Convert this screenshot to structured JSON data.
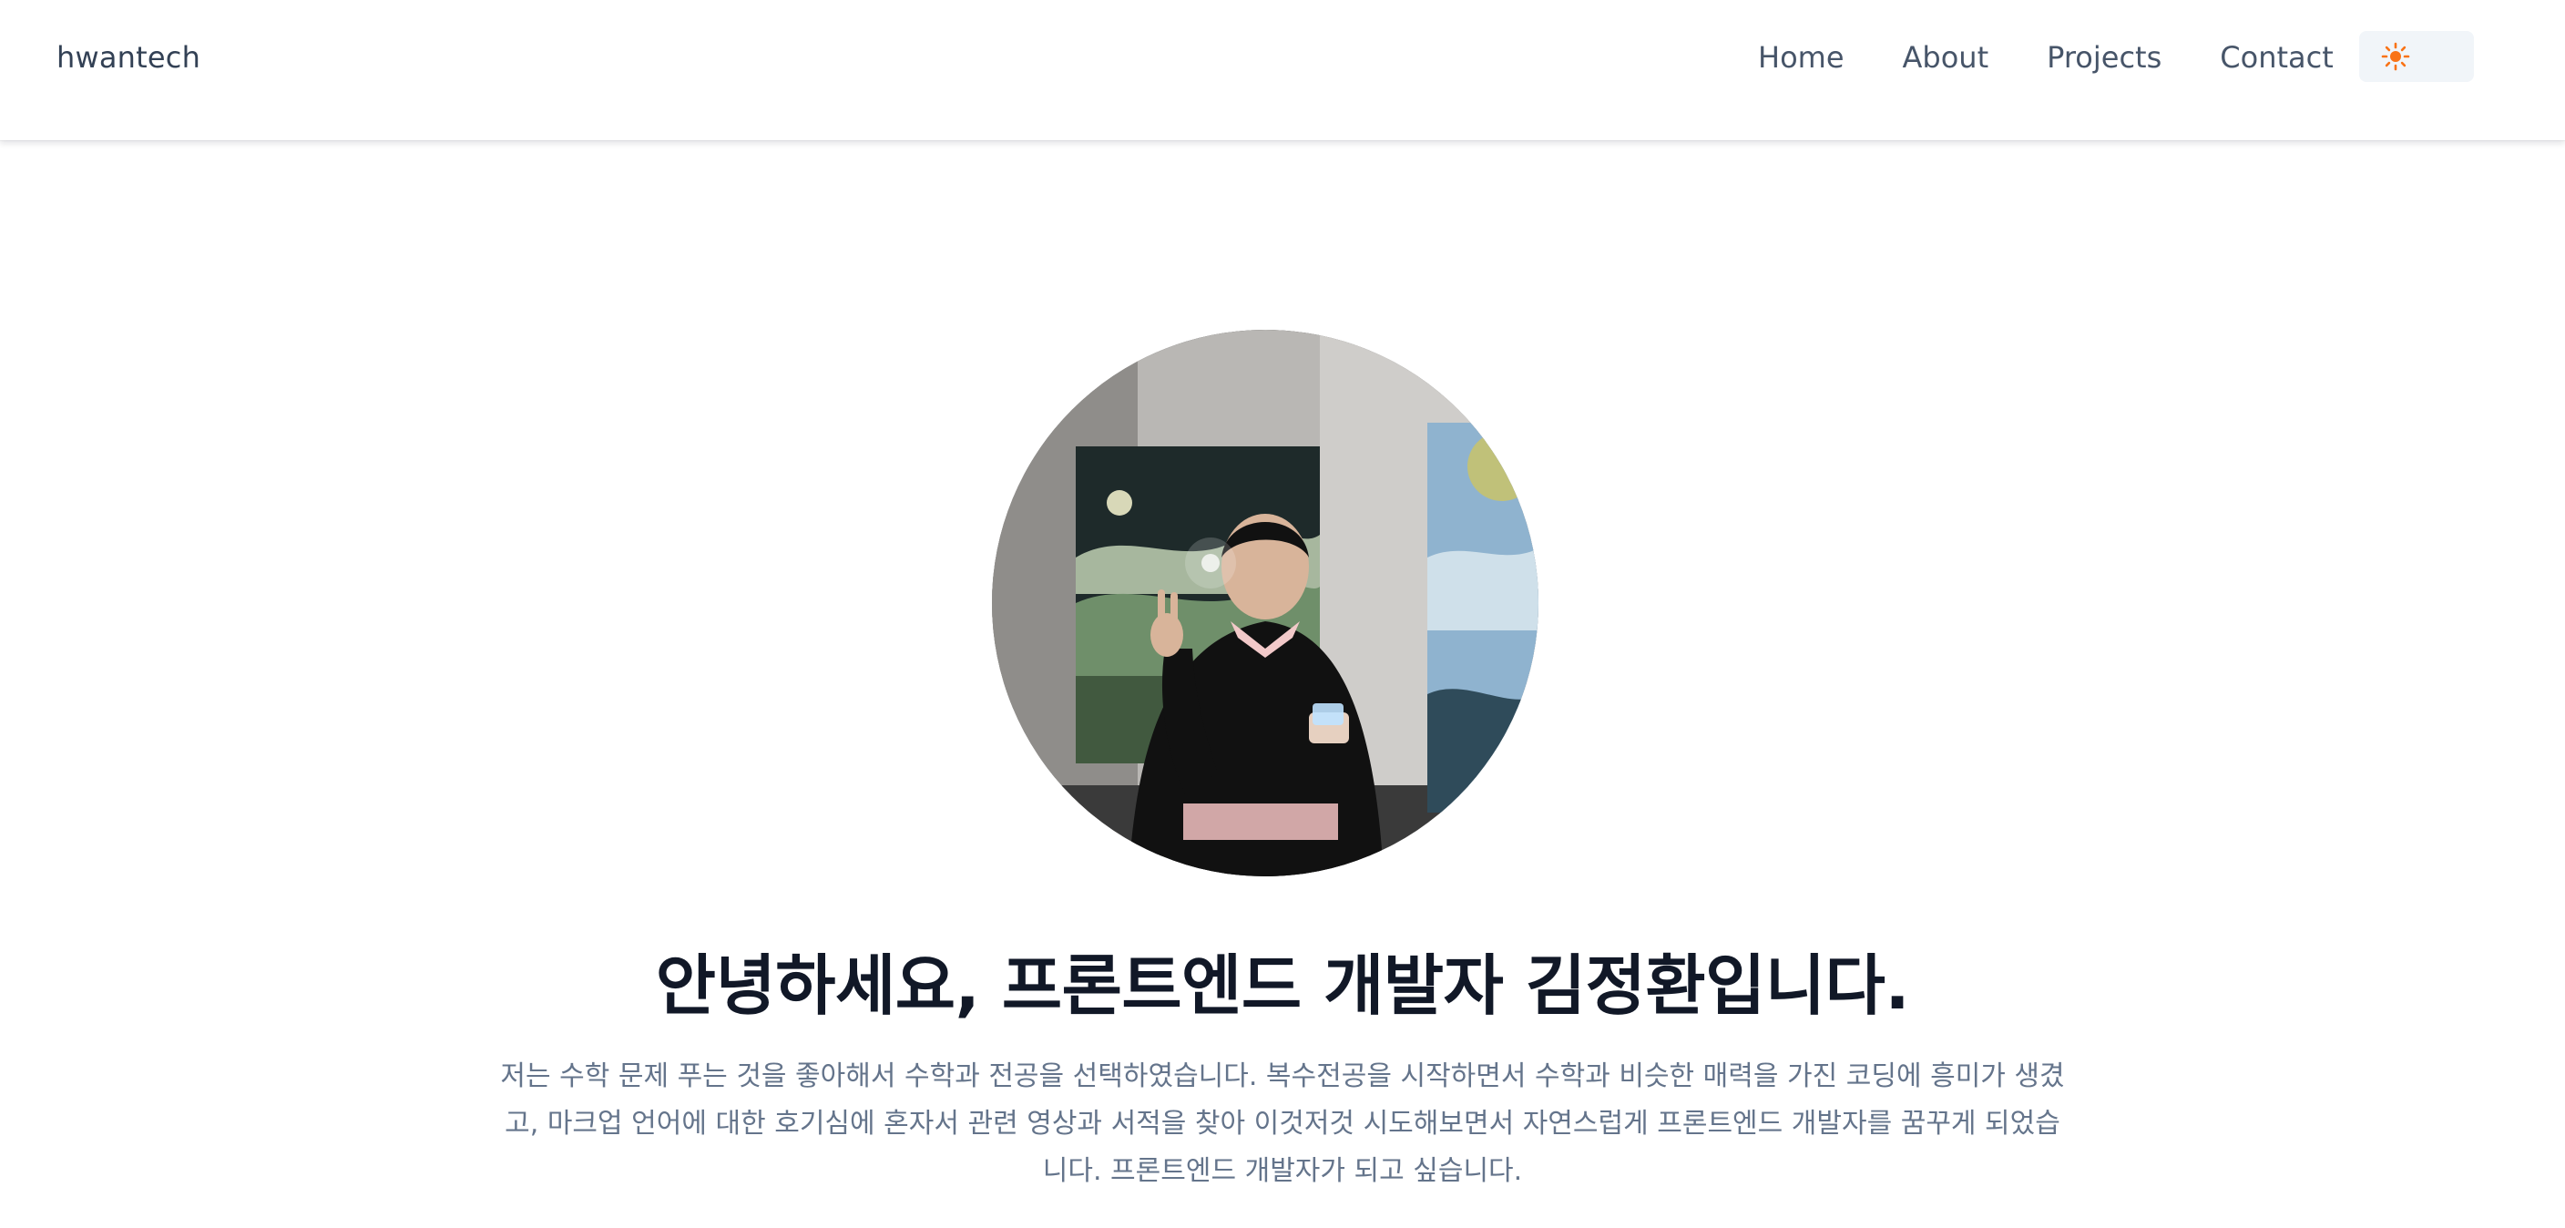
{
  "header": {
    "brand": "hwantech",
    "nav": [
      "Home",
      "About",
      "Projects",
      "Contact"
    ],
    "theme_icon": "sun-icon"
  },
  "hero": {
    "avatar_icon": "profile-photo",
    "headline": "안녕하세요, 프론트엔드 개발자 김정환입니다.",
    "intro": "저는 수학 문제 푸는 것을 좋아해서 수학과 전공을 선택하였습니다. 복수전공을 시작하면서 수학과 비슷한 매력을 가진 코딩에 흥미가 생겼고, 마크업 언어에 대한 호기심에 혼자서 관련 영상과 서적을 찾아 이것저것 시도해보면서 자연스럽게 프론트엔드 개발자를 꿈꾸게 되었습니다. 프론트엔드 개발자가 되고 싶습니다."
  },
  "colors": {
    "brand_text": "#334155",
    "nav_text": "#475569",
    "headline": "#111827",
    "body_text": "#64748b",
    "sun_accent": "#f97316",
    "toggle_bg": "#f1f5f9"
  }
}
